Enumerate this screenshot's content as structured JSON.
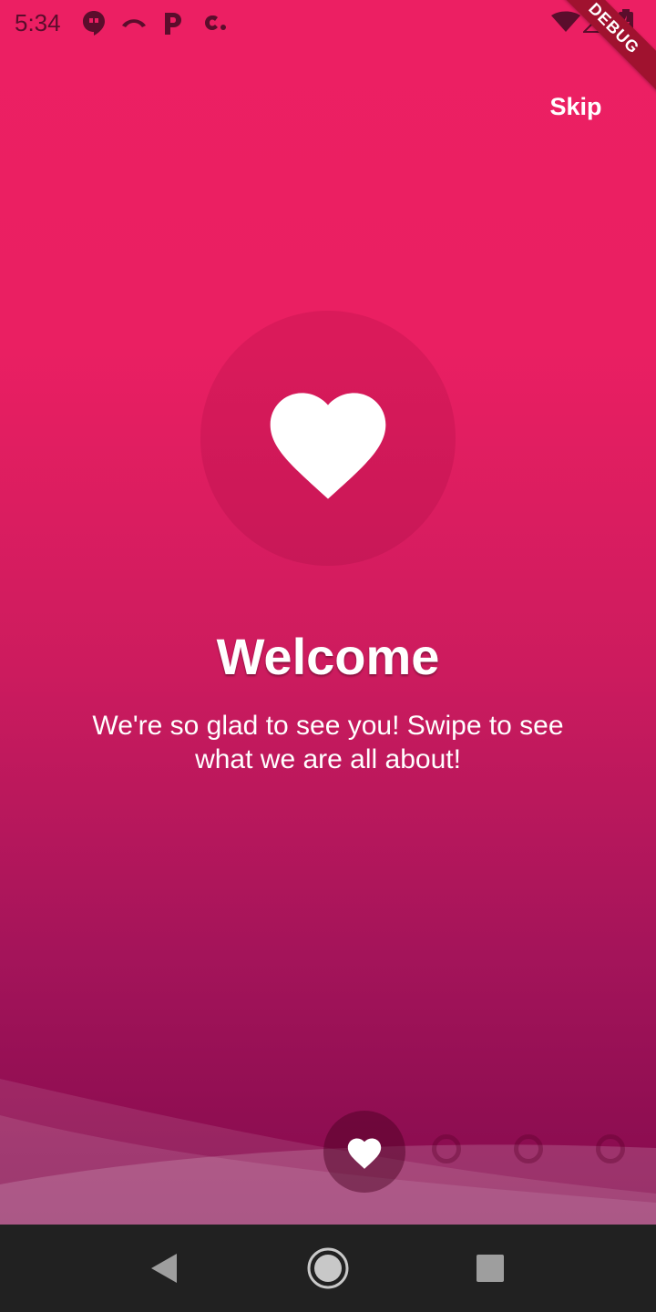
{
  "status_bar": {
    "time": "5:34",
    "icons": [
      "hangouts-icon",
      "missed-call-icon",
      "parking-icon",
      "c-app-icon",
      "wifi-icon",
      "no-signal-icon",
      "battery-charging-icon"
    ]
  },
  "debug_banner": {
    "label": "DEBUG",
    "color": "#a0122f"
  },
  "header": {
    "skip_label": "Skip"
  },
  "hero": {
    "icon": "heart-icon"
  },
  "page": {
    "title": "Welcome",
    "subtitle": "We're so glad to see you! Swipe to see what we are all about!"
  },
  "pager": {
    "total_pages": 4,
    "current_page": 1,
    "active_icon": "heart-icon"
  },
  "colors": {
    "background_top": "#ec1f63",
    "background_bottom": "#830a4d",
    "text": "#ffffff",
    "nav_bar": "#212121"
  },
  "nav_bar": {
    "buttons": [
      "back-icon",
      "home-icon",
      "recents-icon"
    ]
  }
}
